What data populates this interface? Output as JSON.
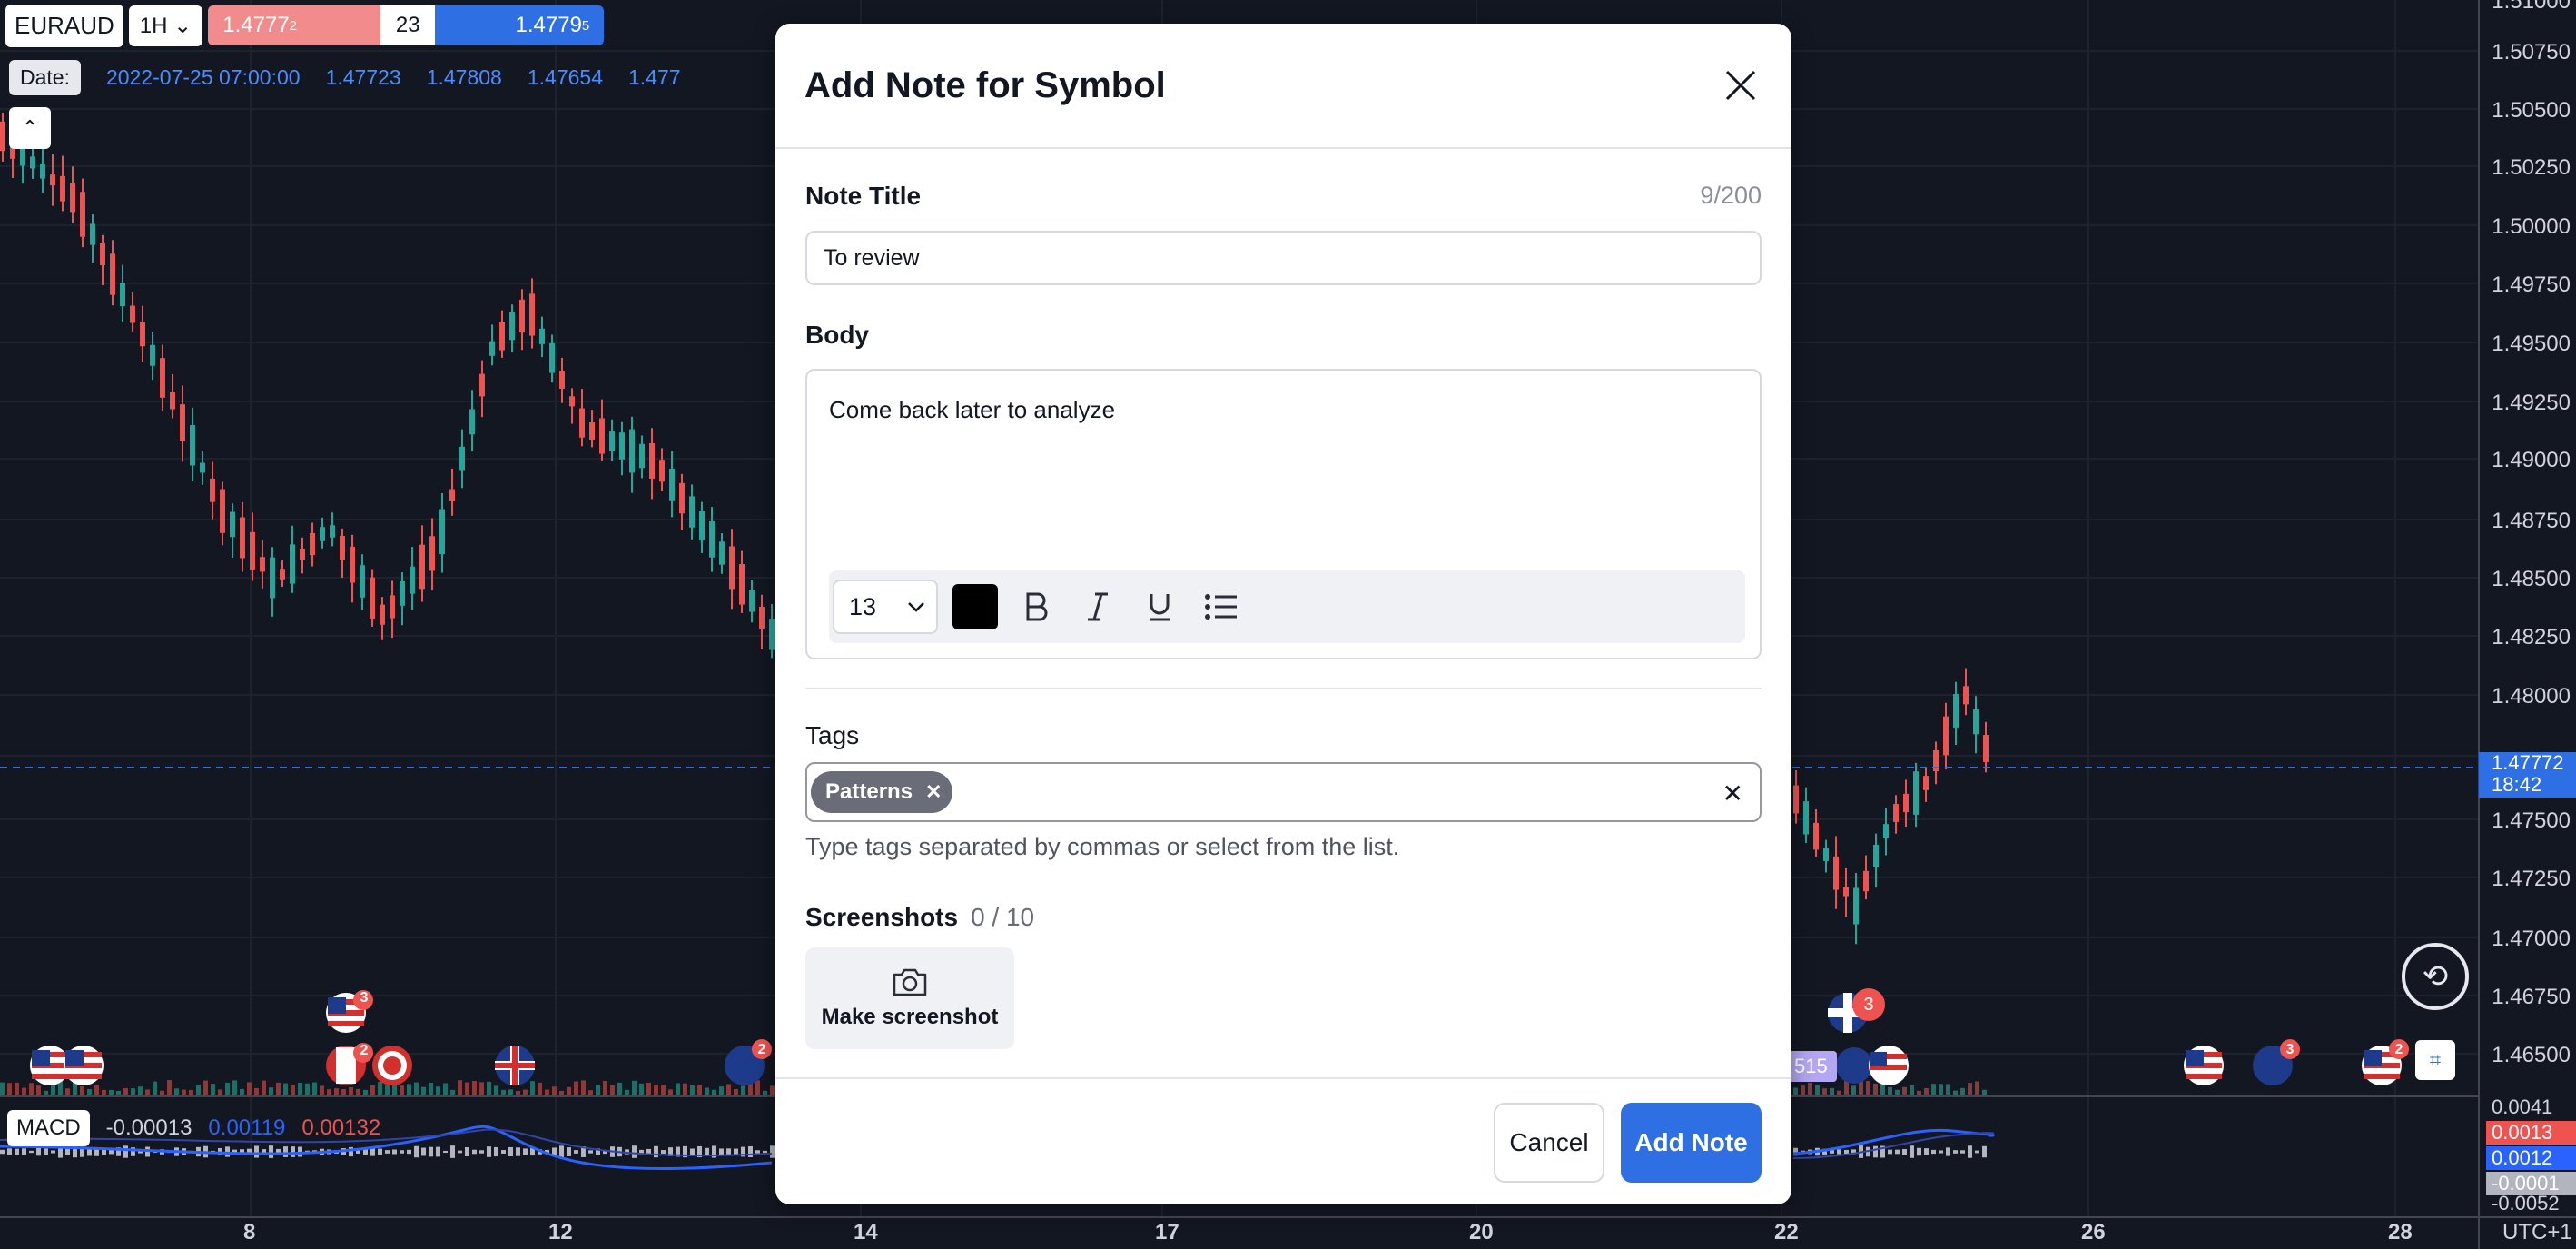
{
  "header": {
    "symbol": "EURAUD",
    "timeframe": "1H",
    "sell_main": "1.4777",
    "sell_sup": "2",
    "spread": "23",
    "buy_main": "1.4779",
    "buy_sup": "5"
  },
  "ohlc": {
    "date_label": "Date:",
    "date": "2022-07-25 07:00:00",
    "open": "1.47723",
    "high": "1.47808",
    "low": "1.47654",
    "close_partial": "1.477"
  },
  "price_axis": [
    "1.51000",
    "1.50750",
    "1.50500",
    "1.50250",
    "1.50000",
    "1.49750",
    "1.49500",
    "1.49250",
    "1.49000",
    "1.48750",
    "1.48500",
    "1.48250",
    "1.48000",
    "1.47500",
    "1.47250",
    "1.47000",
    "1.46750",
    "1.46500"
  ],
  "current_price": {
    "value": "1.47772",
    "countdown": "18:42"
  },
  "macd": {
    "label": "MACD",
    "value1": "-0.00013",
    "value2": "0.00119",
    "value3": "0.00132",
    "axis": [
      "0.0041",
      "0.0013",
      "0.0012",
      "-0.0001",
      "-0.0052"
    ]
  },
  "time_axis": [
    "8",
    "12",
    "14",
    "17",
    "20",
    "22",
    "26",
    "28"
  ],
  "timezone": "UTC+1",
  "chart_overlay": {
    "price_badge": "515"
  },
  "event_badges": [
    "3",
    "2",
    "2",
    "3",
    "2",
    "3"
  ],
  "colors": {
    "up": "#26a69a",
    "down": "#ef5350",
    "accent": "#2f6fe4"
  },
  "modal": {
    "title": "Add Note for Symbol",
    "note_title_label": "Note Title",
    "note_title_counter": "9/200",
    "note_title_value": "To review",
    "body_label": "Body",
    "body_value": "Come back later to analyze",
    "font_size": "13",
    "tags_label": "Tags",
    "tags": [
      "Patterns"
    ],
    "tags_hint": "Type tags separated by commas or select from the list.",
    "screenshots_label": "Screenshots",
    "screenshots_count": "0 / 10",
    "make_screenshot": "Make screenshot",
    "cancel": "Cancel",
    "add_note": "Add Note"
  }
}
